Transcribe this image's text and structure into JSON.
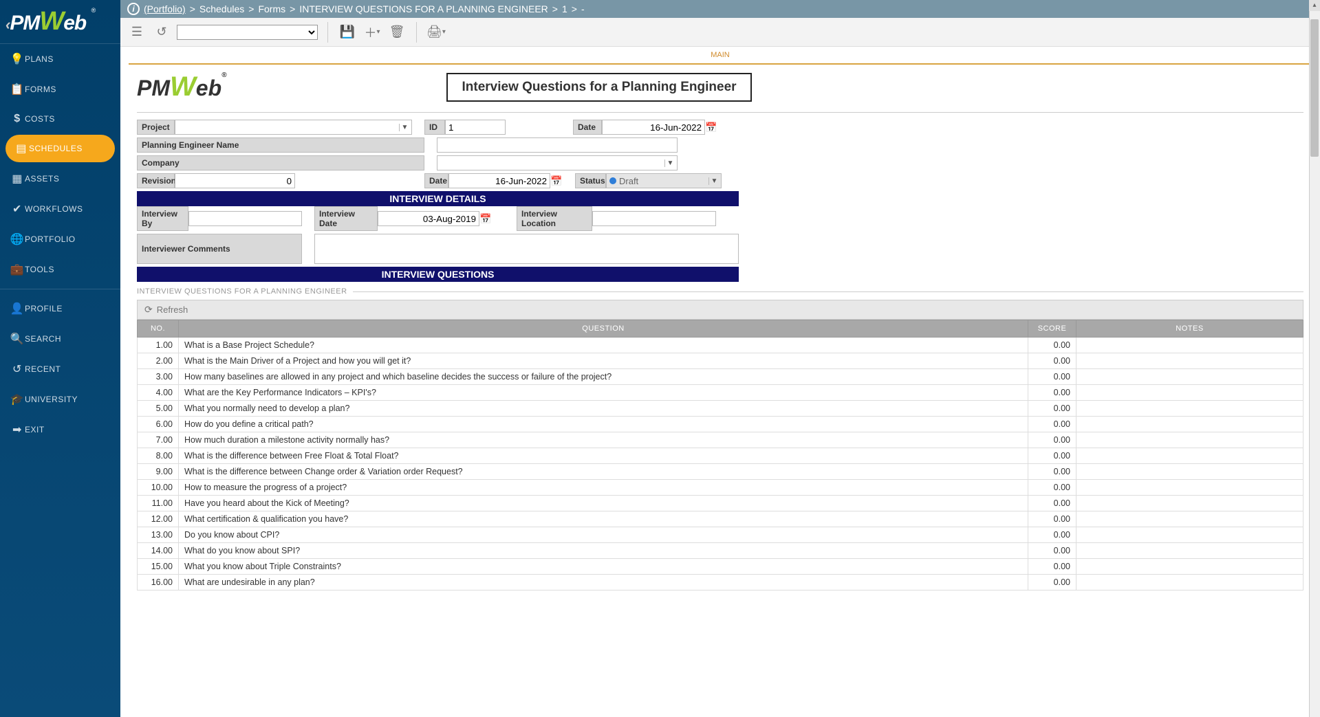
{
  "logo": {
    "pm": "PM",
    "w": "W",
    "eb": "eb",
    "reg": "®"
  },
  "nav": [
    {
      "label": "PLANS",
      "icon": "💡"
    },
    {
      "label": "FORMS",
      "icon": "📋"
    },
    {
      "label": "COSTS",
      "icon": "$"
    },
    {
      "label": "SCHEDULES",
      "icon": "📅",
      "active": true
    },
    {
      "label": "ASSETS",
      "icon": "🏢"
    },
    {
      "label": "WORKFLOWS",
      "icon": "✔"
    },
    {
      "label": "PORTFOLIO",
      "icon": "🌐"
    },
    {
      "label": "TOOLS",
      "icon": "💼"
    }
  ],
  "nav2": [
    {
      "label": "PROFILE",
      "icon": "👤"
    },
    {
      "label": "SEARCH",
      "icon": "🔍"
    },
    {
      "label": "RECENT",
      "icon": "↺"
    },
    {
      "label": "UNIVERSITY",
      "icon": "🎓"
    },
    {
      "label": "EXIT",
      "icon": "➡"
    }
  ],
  "breadcrumb": {
    "portfolio": "(Portfolio)",
    "schedules": "Schedules",
    "forms": "Forms",
    "title": "INTERVIEW QUESTIONS FOR A PLANNING ENGINEER",
    "id": "1",
    "tail": "-"
  },
  "tab": "MAIN",
  "form": {
    "title": "Interview Questions for a Planning Engineer",
    "project_label": "Project",
    "id_label": "ID",
    "id_value": "1",
    "date_label": "Date",
    "date_value": "16-Jun-2022",
    "engineer_label": "Planning Engineer Name",
    "company_label": "Company",
    "revision_label": "Revision",
    "revision_value": "0",
    "date2_label": "Date",
    "date2_value": "16-Jun-2022",
    "status_label": "Status",
    "status_value": "Draft",
    "section1": "INTERVIEW DETAILS",
    "interview_by_label": "Interview By",
    "interview_date_label": "Interview Date",
    "interview_date_value": "03-Aug-2019",
    "interview_location_label": "Interview Location",
    "comments_label": "Interviewer Comments",
    "section2": "INTERVIEW QUESTIONS"
  },
  "section_heading": "INTERVIEW QUESTIONS FOR A PLANNING ENGINEER",
  "grid": {
    "refresh": "Refresh",
    "headers": {
      "no": "NO.",
      "question": "QUESTION",
      "score": "SCORE",
      "notes": "NOTES"
    },
    "rows": [
      {
        "no": "1.00",
        "q": "What is a Base Project Schedule?",
        "score": "0.00"
      },
      {
        "no": "2.00",
        "q": "What is the Main Driver of a Project and how you will get it?",
        "score": "0.00"
      },
      {
        "no": "3.00",
        "q": "How many baselines are allowed in any project and which baseline decides the success or failure of the project?",
        "score": "0.00"
      },
      {
        "no": "4.00",
        "q": "What are the Key Performance Indicators – KPI's?",
        "score": "0.00"
      },
      {
        "no": "5.00",
        "q": "What you normally need to develop a plan?",
        "score": "0.00"
      },
      {
        "no": "6.00",
        "q": "How do you define a critical path?",
        "score": "0.00"
      },
      {
        "no": "7.00",
        "q": "How much duration a milestone activity normally has?",
        "score": "0.00"
      },
      {
        "no": "8.00",
        "q": "What is the difference between Free Float & Total Float?",
        "score": "0.00"
      },
      {
        "no": "9.00",
        "q": "What is the difference between Change order & Variation order Request?",
        "score": "0.00"
      },
      {
        "no": "10.00",
        "q": "How to measure the progress of a project?",
        "score": "0.00"
      },
      {
        "no": "11.00",
        "q": "Have you heard about the Kick of Meeting?",
        "score": "0.00"
      },
      {
        "no": "12.00",
        "q": "What certification & qualification you have?",
        "score": "0.00"
      },
      {
        "no": "13.00",
        "q": "Do you know about CPI?",
        "score": "0.00"
      },
      {
        "no": "14.00",
        "q": "What do you know about SPI?",
        "score": "0.00"
      },
      {
        "no": "15.00",
        "q": "What you know about Triple Constraints?",
        "score": "0.00"
      },
      {
        "no": "16.00",
        "q": "What are undesirable in any plan?",
        "score": "0.00"
      }
    ]
  }
}
